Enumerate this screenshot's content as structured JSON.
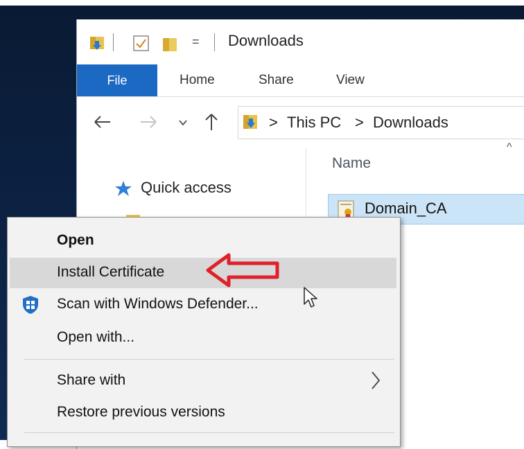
{
  "window": {
    "title": "Downloads",
    "title_dropdown_glyph": "="
  },
  "ribbon": {
    "tabs": [
      {
        "label": "File",
        "active": true
      },
      {
        "label": "Home"
      },
      {
        "label": "Share"
      },
      {
        "label": "View"
      }
    ]
  },
  "navigation": {
    "back_icon": "back-arrow-icon",
    "forward_icon": "forward-arrow-icon",
    "recent_icon": "chevron-down-icon",
    "up_icon": "up-arrow-icon",
    "breadcrumb": [
      "This PC",
      "Downloads"
    ],
    "breadcrumb_separator": ">"
  },
  "nav_pane": {
    "quick_access_label": "Quick access"
  },
  "file_list": {
    "column_header": "Name",
    "sort_glyph": "^",
    "items": [
      {
        "name": "Domain_CA",
        "icon": "certificate-file-icon",
        "selected": true
      }
    ]
  },
  "context_menu": {
    "items": [
      {
        "label": "Open",
        "bold": true
      },
      {
        "label": "Install Certificate",
        "highlighted": true
      },
      {
        "label": "Scan with Windows Defender...",
        "icon": "windows-defender-shield-icon"
      },
      {
        "label": "Open with..."
      },
      {
        "label": "Share with",
        "has_submenu": true
      },
      {
        "label": "Restore previous versions"
      }
    ]
  },
  "colors": {
    "accent": "#1c69c4",
    "selection": "#cce4f7",
    "menu_highlight": "#d8d8d8",
    "annotation_arrow": "#e0202a"
  }
}
